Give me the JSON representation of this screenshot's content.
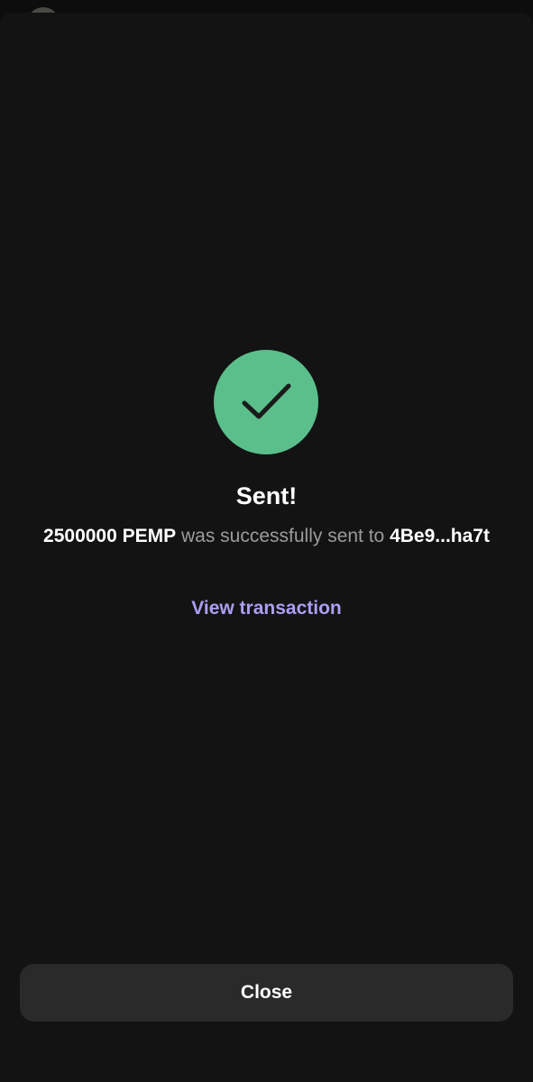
{
  "success": {
    "icon": "checkmark-icon",
    "color": "#5bbf8c"
  },
  "title": "Sent!",
  "message": {
    "amount": "2500000 PEMP",
    "middle": " was successfully sent to ",
    "recipient": "4Be9...ha7t"
  },
  "view_transaction_label": "View transaction",
  "close_label": "Close",
  "colors": {
    "background": "#131313",
    "accent": "#ab9ff2",
    "button": "#2a2a2a"
  }
}
